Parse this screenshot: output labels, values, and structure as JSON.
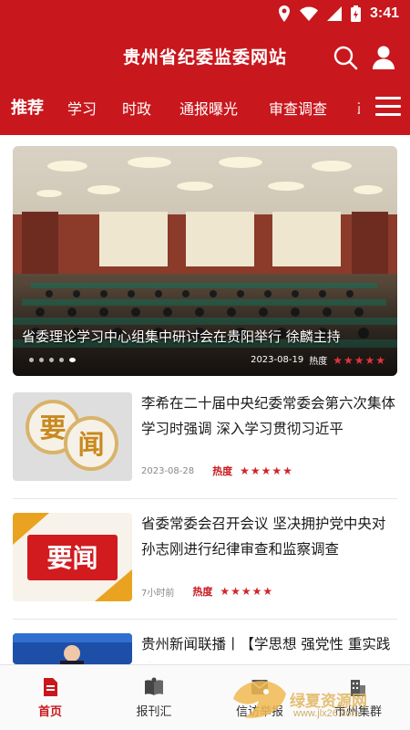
{
  "status_bar": {
    "time": "3:41"
  },
  "header": {
    "title": "贵州省纪委监委网站"
  },
  "tabs": [
    {
      "label": "推荐",
      "active": true
    },
    {
      "label": "学习"
    },
    {
      "label": "时政"
    },
    {
      "label": "通报曝光"
    },
    {
      "label": "审查调查"
    },
    {
      "label": "政"
    }
  ],
  "hero": {
    "caption": "省委理论学习中心组集中研讨会在贵阳举行 徐麟主持",
    "date": "2023-08-19",
    "heat_label": "热度",
    "stars": "★★★★★",
    "slide_count": 5,
    "active_slide": 5
  },
  "news": [
    {
      "title": "李希在二十届中央纪委常委会第六次集体学习时强调 深入学习贯彻习近平",
      "time": "2023-08-28",
      "heat_label": "热度",
      "stars": "★★★★★",
      "thumb_text": [
        "要",
        "闻"
      ]
    },
    {
      "title": "省委常委会召开会议 坚决拥护党中央对孙志刚进行纪律审查和监察调查",
      "time": "7小时前",
      "heat_label": "热度",
      "stars": "★★★★★",
      "thumb_text": "要闻"
    },
    {
      "title": "贵州新闻联播丨【学思想 强党性 重实践 建新功】"
    }
  ],
  "bottom_nav": [
    {
      "label": "首页",
      "icon": "document-icon",
      "active": true
    },
    {
      "label": "报刊汇",
      "icon": "book-icon"
    },
    {
      "label": "信访举报",
      "icon": "report-icon"
    },
    {
      "label": "市州集群",
      "icon": "building-icon"
    }
  ],
  "watermark": {
    "text": "绿夏资源网",
    "url": "www.jlx26.com"
  },
  "colors": {
    "brand_red": "#c8171d",
    "star_red": "#e5323a"
  }
}
